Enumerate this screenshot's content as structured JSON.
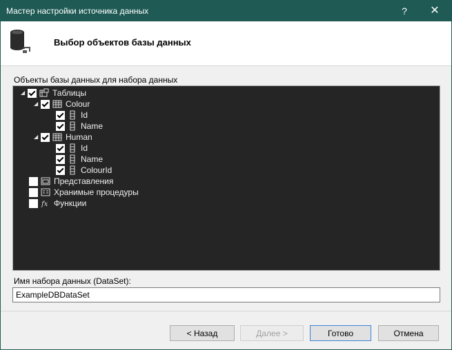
{
  "window": {
    "title": "Мастер настройки источника данных",
    "help_glyph": "?",
    "close_glyph": "✕"
  },
  "header": {
    "heading": "Выбор объектов базы данных"
  },
  "objects_label": "Объекты базы данных для набора данных",
  "tree": {
    "tables": {
      "label": "Таблицы",
      "checked": true,
      "expanded": true
    },
    "colour": {
      "label": "Colour",
      "checked": true,
      "expanded": true,
      "columns": [
        {
          "label": "Id",
          "checked": true
        },
        {
          "label": "Name",
          "checked": true
        }
      ]
    },
    "human": {
      "label": "Human",
      "checked": true,
      "expanded": true,
      "columns": [
        {
          "label": "Id",
          "checked": true
        },
        {
          "label": "Name",
          "checked": true
        },
        {
          "label": "ColourId",
          "checked": true
        }
      ]
    },
    "views": {
      "label": "Представления",
      "checked": false
    },
    "procedures": {
      "label": "Хранимые процедуры",
      "checked": false
    },
    "functions": {
      "label": "Функции",
      "checked": false
    }
  },
  "dataset": {
    "label": "Имя набора данных (DataSet):",
    "value": "ExampleDBDataSet"
  },
  "buttons": {
    "back": "< Назад",
    "next": "Далее >",
    "finish": "Готово",
    "cancel": "Отмена"
  },
  "colors": {
    "titlebar": "#1f5a55",
    "tree_background": "#252526",
    "focus_border": "#3b82d6"
  }
}
